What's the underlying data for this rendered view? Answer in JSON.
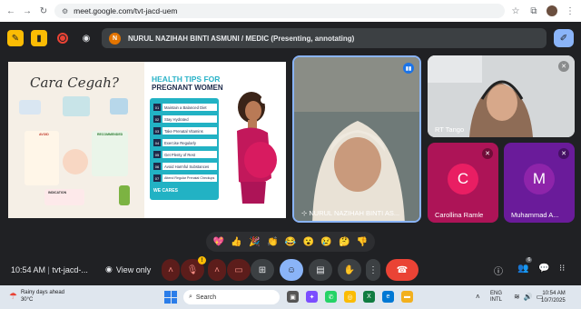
{
  "browser": {
    "url": "meet.google.com/tvt-jacd-uem"
  },
  "topbar": {
    "presenter_initial": "N",
    "presenting_text": "NURUL NAZIHAH BINTI ASMUNI / MEDIC (Presenting, annotating)"
  },
  "slide": {
    "heading": "Cara Cegah?",
    "left_labels": [
      "AVOID",
      "RECOMMENDED",
      "INDICATION"
    ],
    "title_line1": "HEALTH TIPS FOR",
    "title_line2": "PREGNANT  WOMEN",
    "tips": [
      {
        "num": "01",
        "label": "Maintain a Balanced Diet"
      },
      {
        "num": "02",
        "label": "Stay Hydrated"
      },
      {
        "num": "03",
        "label": "Take Prenatal Vitamins"
      },
      {
        "num": "04",
        "label": "Exercise Regularly"
      },
      {
        "num": "05",
        "label": "Get Plenty of Rest"
      },
      {
        "num": "06",
        "label": "Avoid Harmful Substances"
      },
      {
        "num": "07",
        "label": "Attend Regular Prenatal Checkups"
      }
    ],
    "footer": "WE CARES"
  },
  "participants": [
    {
      "name": "NURUL NAZIHAH BINTI AS...",
      "state": "speaking"
    },
    {
      "name": "RT Tango",
      "state": "muted"
    },
    {
      "name": "Carollina Ramle",
      "initial": "C",
      "color": "#c2185b",
      "state": "muted"
    },
    {
      "name": "Muhammad A...",
      "initial": "M",
      "color": "#7b1fa2",
      "state": "muted"
    }
  ],
  "reactions": [
    "💖",
    "👍",
    "🎉",
    "👏",
    "😂",
    "😮",
    "😢",
    "🤔",
    "👎"
  ],
  "bottombar": {
    "time": "10:54 AM",
    "meeting_code": "tvt-jacd-...",
    "view_only": "View only",
    "participant_count": "6"
  },
  "taskbar": {
    "weather_line1": "Rainy days ahead",
    "weather_line2": "30°C",
    "search_placeholder": "Search",
    "lang_line1": "ENG",
    "lang_line2": "INTL",
    "time": "10:54 AM",
    "date": "10/7/2025"
  },
  "colors": {
    "meet_bg": "#202124",
    "accent_blue": "#8ab4f8",
    "end_call_red": "#ea4335",
    "teal": "#22b2c4"
  }
}
